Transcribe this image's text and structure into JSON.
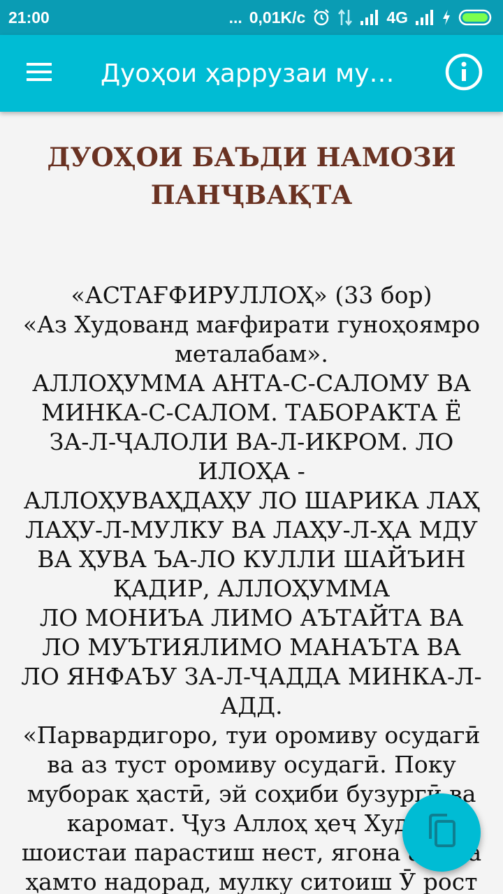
{
  "status_bar": {
    "time": "21:00",
    "dots": "...",
    "speed": "0,01K/c",
    "network": "4G",
    "battery_color": "#7cff4f"
  },
  "app_bar": {
    "title": "Дуоҳои ҳаррузаи мус...",
    "menu_icon": "hamburger-menu-icon",
    "info_icon": "info-icon"
  },
  "content": {
    "heading": "ДУОҲОИ БАЪДИ НАМОЗИ ПАНҶВАҚТА",
    "paragraphs": [
      "«АСТАҒФИРУЛЛОҲ» (33 бор)",
      "«Аз Худованд мағфирати гуноҳоямро металабам».",
      "АЛЛОҲУММА АНТА-С-САЛОМУ ВА МИНКА-С-САЛОМ. ТАБОРАКТА Ё ЗА-Л-ҶАЛОЛИ ВА-Л-ИКРОМ. ЛО ИЛОҲА -",
      "АЛЛОҲУВАҲДАҲУ ЛО ШАРИКА ЛАҲ ЛАҲУ-Л-МУЛКУ ВА ЛАҲУ-Л-ҲА МДУ ВА ҲУВА ЪА-ЛО КУЛЛИ ШАЙЪИН ҚАДИР, АЛЛОҲУММА",
      "ЛО МОНИЪА ЛИМО АЪТАЙТА ВА",
      "ЛО МУЪТИЯЛИМО МАНАЪТА ВА",
      "ЛО ЯНФАЪУ ЗА-Л-ҶАДДА МИНКА-Л-АДД.",
      "«Парвардигоро, туи оромиву осудагӣ ва аз туст оромиву осудагӣ. Поку муборак ҳастӣ, эй соҳиби бузургӣ ва каромат. Ҷуз Аллоҳ ҳеҷ Худое шоистаи парастиш нест, ягона аст ва ҳамто надорад, мулку ситоиш Ӯ рост ва Ӯ бар ҳама чиз"
    ]
  },
  "fab": {
    "icon": "copy-icon"
  },
  "colors": {
    "status_bar": "#0a9cb4",
    "app_bar": "#00bcd4",
    "heading": "#6a3222",
    "background": "#f4f4f4"
  }
}
